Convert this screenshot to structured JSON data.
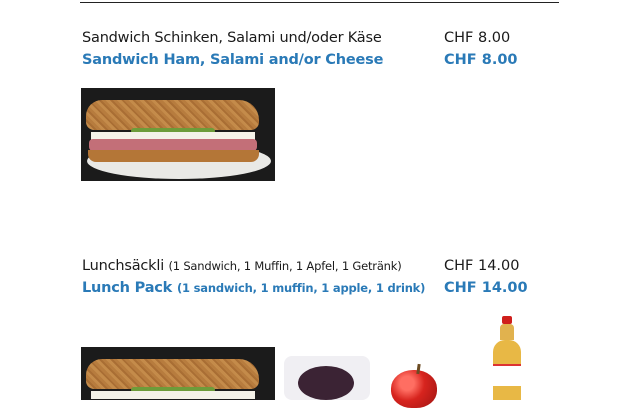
{
  "menu": {
    "items": [
      {
        "name_de": "Sandwich Schinken, Salami und/oder Käse",
        "name_en": "Sandwich Ham, Salami and/or Cheese",
        "price_de": "CHF 8.00",
        "price_en": "CHF 8.00"
      },
      {
        "name_de": "Lunchsäckli",
        "detail_de": "(1 Sandwich, 1 Muffin, 1 Apfel, 1 Getränk)",
        "name_en": "Lunch Pack",
        "detail_en": "(1 sandwich, 1 muffin, 1 apple, 1 drink)",
        "price_de": "CHF 14.00",
        "price_en": "CHF 14.00"
      }
    ]
  }
}
